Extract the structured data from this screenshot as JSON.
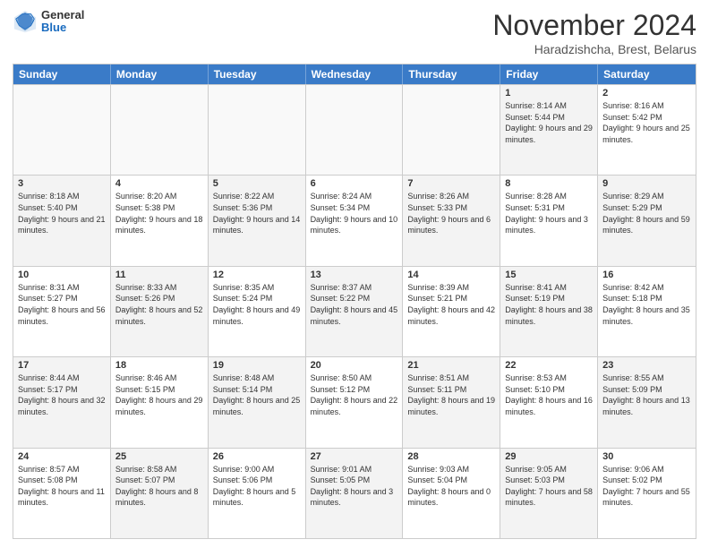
{
  "header": {
    "logo_general": "General",
    "logo_blue": "Blue",
    "month_title": "November 2024",
    "subtitle": "Haradzishcha, Brest, Belarus"
  },
  "calendar": {
    "days_of_week": [
      "Sunday",
      "Monday",
      "Tuesday",
      "Wednesday",
      "Thursday",
      "Friday",
      "Saturday"
    ],
    "rows": [
      [
        {
          "day": "",
          "info": "",
          "empty": true
        },
        {
          "day": "",
          "info": "",
          "empty": true
        },
        {
          "day": "",
          "info": "",
          "empty": true
        },
        {
          "day": "",
          "info": "",
          "empty": true
        },
        {
          "day": "",
          "info": "",
          "empty": true
        },
        {
          "day": "1",
          "info": "Sunrise: 8:14 AM\nSunset: 5:44 PM\nDaylight: 9 hours and 29 minutes.",
          "shaded": true
        },
        {
          "day": "2",
          "info": "Sunrise: 8:16 AM\nSunset: 5:42 PM\nDaylight: 9 hours and 25 minutes.",
          "shaded": false
        }
      ],
      [
        {
          "day": "3",
          "info": "Sunrise: 8:18 AM\nSunset: 5:40 PM\nDaylight: 9 hours and 21 minutes.",
          "shaded": true
        },
        {
          "day": "4",
          "info": "Sunrise: 8:20 AM\nSunset: 5:38 PM\nDaylight: 9 hours and 18 minutes.",
          "shaded": false
        },
        {
          "day": "5",
          "info": "Sunrise: 8:22 AM\nSunset: 5:36 PM\nDaylight: 9 hours and 14 minutes.",
          "shaded": true
        },
        {
          "day": "6",
          "info": "Sunrise: 8:24 AM\nSunset: 5:34 PM\nDaylight: 9 hours and 10 minutes.",
          "shaded": false
        },
        {
          "day": "7",
          "info": "Sunrise: 8:26 AM\nSunset: 5:33 PM\nDaylight: 9 hours and 6 minutes.",
          "shaded": true
        },
        {
          "day": "8",
          "info": "Sunrise: 8:28 AM\nSunset: 5:31 PM\nDaylight: 9 hours and 3 minutes.",
          "shaded": false
        },
        {
          "day": "9",
          "info": "Sunrise: 8:29 AM\nSunset: 5:29 PM\nDaylight: 8 hours and 59 minutes.",
          "shaded": true
        }
      ],
      [
        {
          "day": "10",
          "info": "Sunrise: 8:31 AM\nSunset: 5:27 PM\nDaylight: 8 hours and 56 minutes.",
          "shaded": false
        },
        {
          "day": "11",
          "info": "Sunrise: 8:33 AM\nSunset: 5:26 PM\nDaylight: 8 hours and 52 minutes.",
          "shaded": true
        },
        {
          "day": "12",
          "info": "Sunrise: 8:35 AM\nSunset: 5:24 PM\nDaylight: 8 hours and 49 minutes.",
          "shaded": false
        },
        {
          "day": "13",
          "info": "Sunrise: 8:37 AM\nSunset: 5:22 PM\nDaylight: 8 hours and 45 minutes.",
          "shaded": true
        },
        {
          "day": "14",
          "info": "Sunrise: 8:39 AM\nSunset: 5:21 PM\nDaylight: 8 hours and 42 minutes.",
          "shaded": false
        },
        {
          "day": "15",
          "info": "Sunrise: 8:41 AM\nSunset: 5:19 PM\nDaylight: 8 hours and 38 minutes.",
          "shaded": true
        },
        {
          "day": "16",
          "info": "Sunrise: 8:42 AM\nSunset: 5:18 PM\nDaylight: 8 hours and 35 minutes.",
          "shaded": false
        }
      ],
      [
        {
          "day": "17",
          "info": "Sunrise: 8:44 AM\nSunset: 5:17 PM\nDaylight: 8 hours and 32 minutes.",
          "shaded": true
        },
        {
          "day": "18",
          "info": "Sunrise: 8:46 AM\nSunset: 5:15 PM\nDaylight: 8 hours and 29 minutes.",
          "shaded": false
        },
        {
          "day": "19",
          "info": "Sunrise: 8:48 AM\nSunset: 5:14 PM\nDaylight: 8 hours and 25 minutes.",
          "shaded": true
        },
        {
          "day": "20",
          "info": "Sunrise: 8:50 AM\nSunset: 5:12 PM\nDaylight: 8 hours and 22 minutes.",
          "shaded": false
        },
        {
          "day": "21",
          "info": "Sunrise: 8:51 AM\nSunset: 5:11 PM\nDaylight: 8 hours and 19 minutes.",
          "shaded": true
        },
        {
          "day": "22",
          "info": "Sunrise: 8:53 AM\nSunset: 5:10 PM\nDaylight: 8 hours and 16 minutes.",
          "shaded": false
        },
        {
          "day": "23",
          "info": "Sunrise: 8:55 AM\nSunset: 5:09 PM\nDaylight: 8 hours and 13 minutes.",
          "shaded": true
        }
      ],
      [
        {
          "day": "24",
          "info": "Sunrise: 8:57 AM\nSunset: 5:08 PM\nDaylight: 8 hours and 11 minutes.",
          "shaded": false
        },
        {
          "day": "25",
          "info": "Sunrise: 8:58 AM\nSunset: 5:07 PM\nDaylight: 8 hours and 8 minutes.",
          "shaded": true
        },
        {
          "day": "26",
          "info": "Sunrise: 9:00 AM\nSunset: 5:06 PM\nDaylight: 8 hours and 5 minutes.",
          "shaded": false
        },
        {
          "day": "27",
          "info": "Sunrise: 9:01 AM\nSunset: 5:05 PM\nDaylight: 8 hours and 3 minutes.",
          "shaded": true
        },
        {
          "day": "28",
          "info": "Sunrise: 9:03 AM\nSunset: 5:04 PM\nDaylight: 8 hours and 0 minutes.",
          "shaded": false
        },
        {
          "day": "29",
          "info": "Sunrise: 9:05 AM\nSunset: 5:03 PM\nDaylight: 7 hours and 58 minutes.",
          "shaded": true
        },
        {
          "day": "30",
          "info": "Sunrise: 9:06 AM\nSunset: 5:02 PM\nDaylight: 7 hours and 55 minutes.",
          "shaded": false
        }
      ]
    ]
  }
}
